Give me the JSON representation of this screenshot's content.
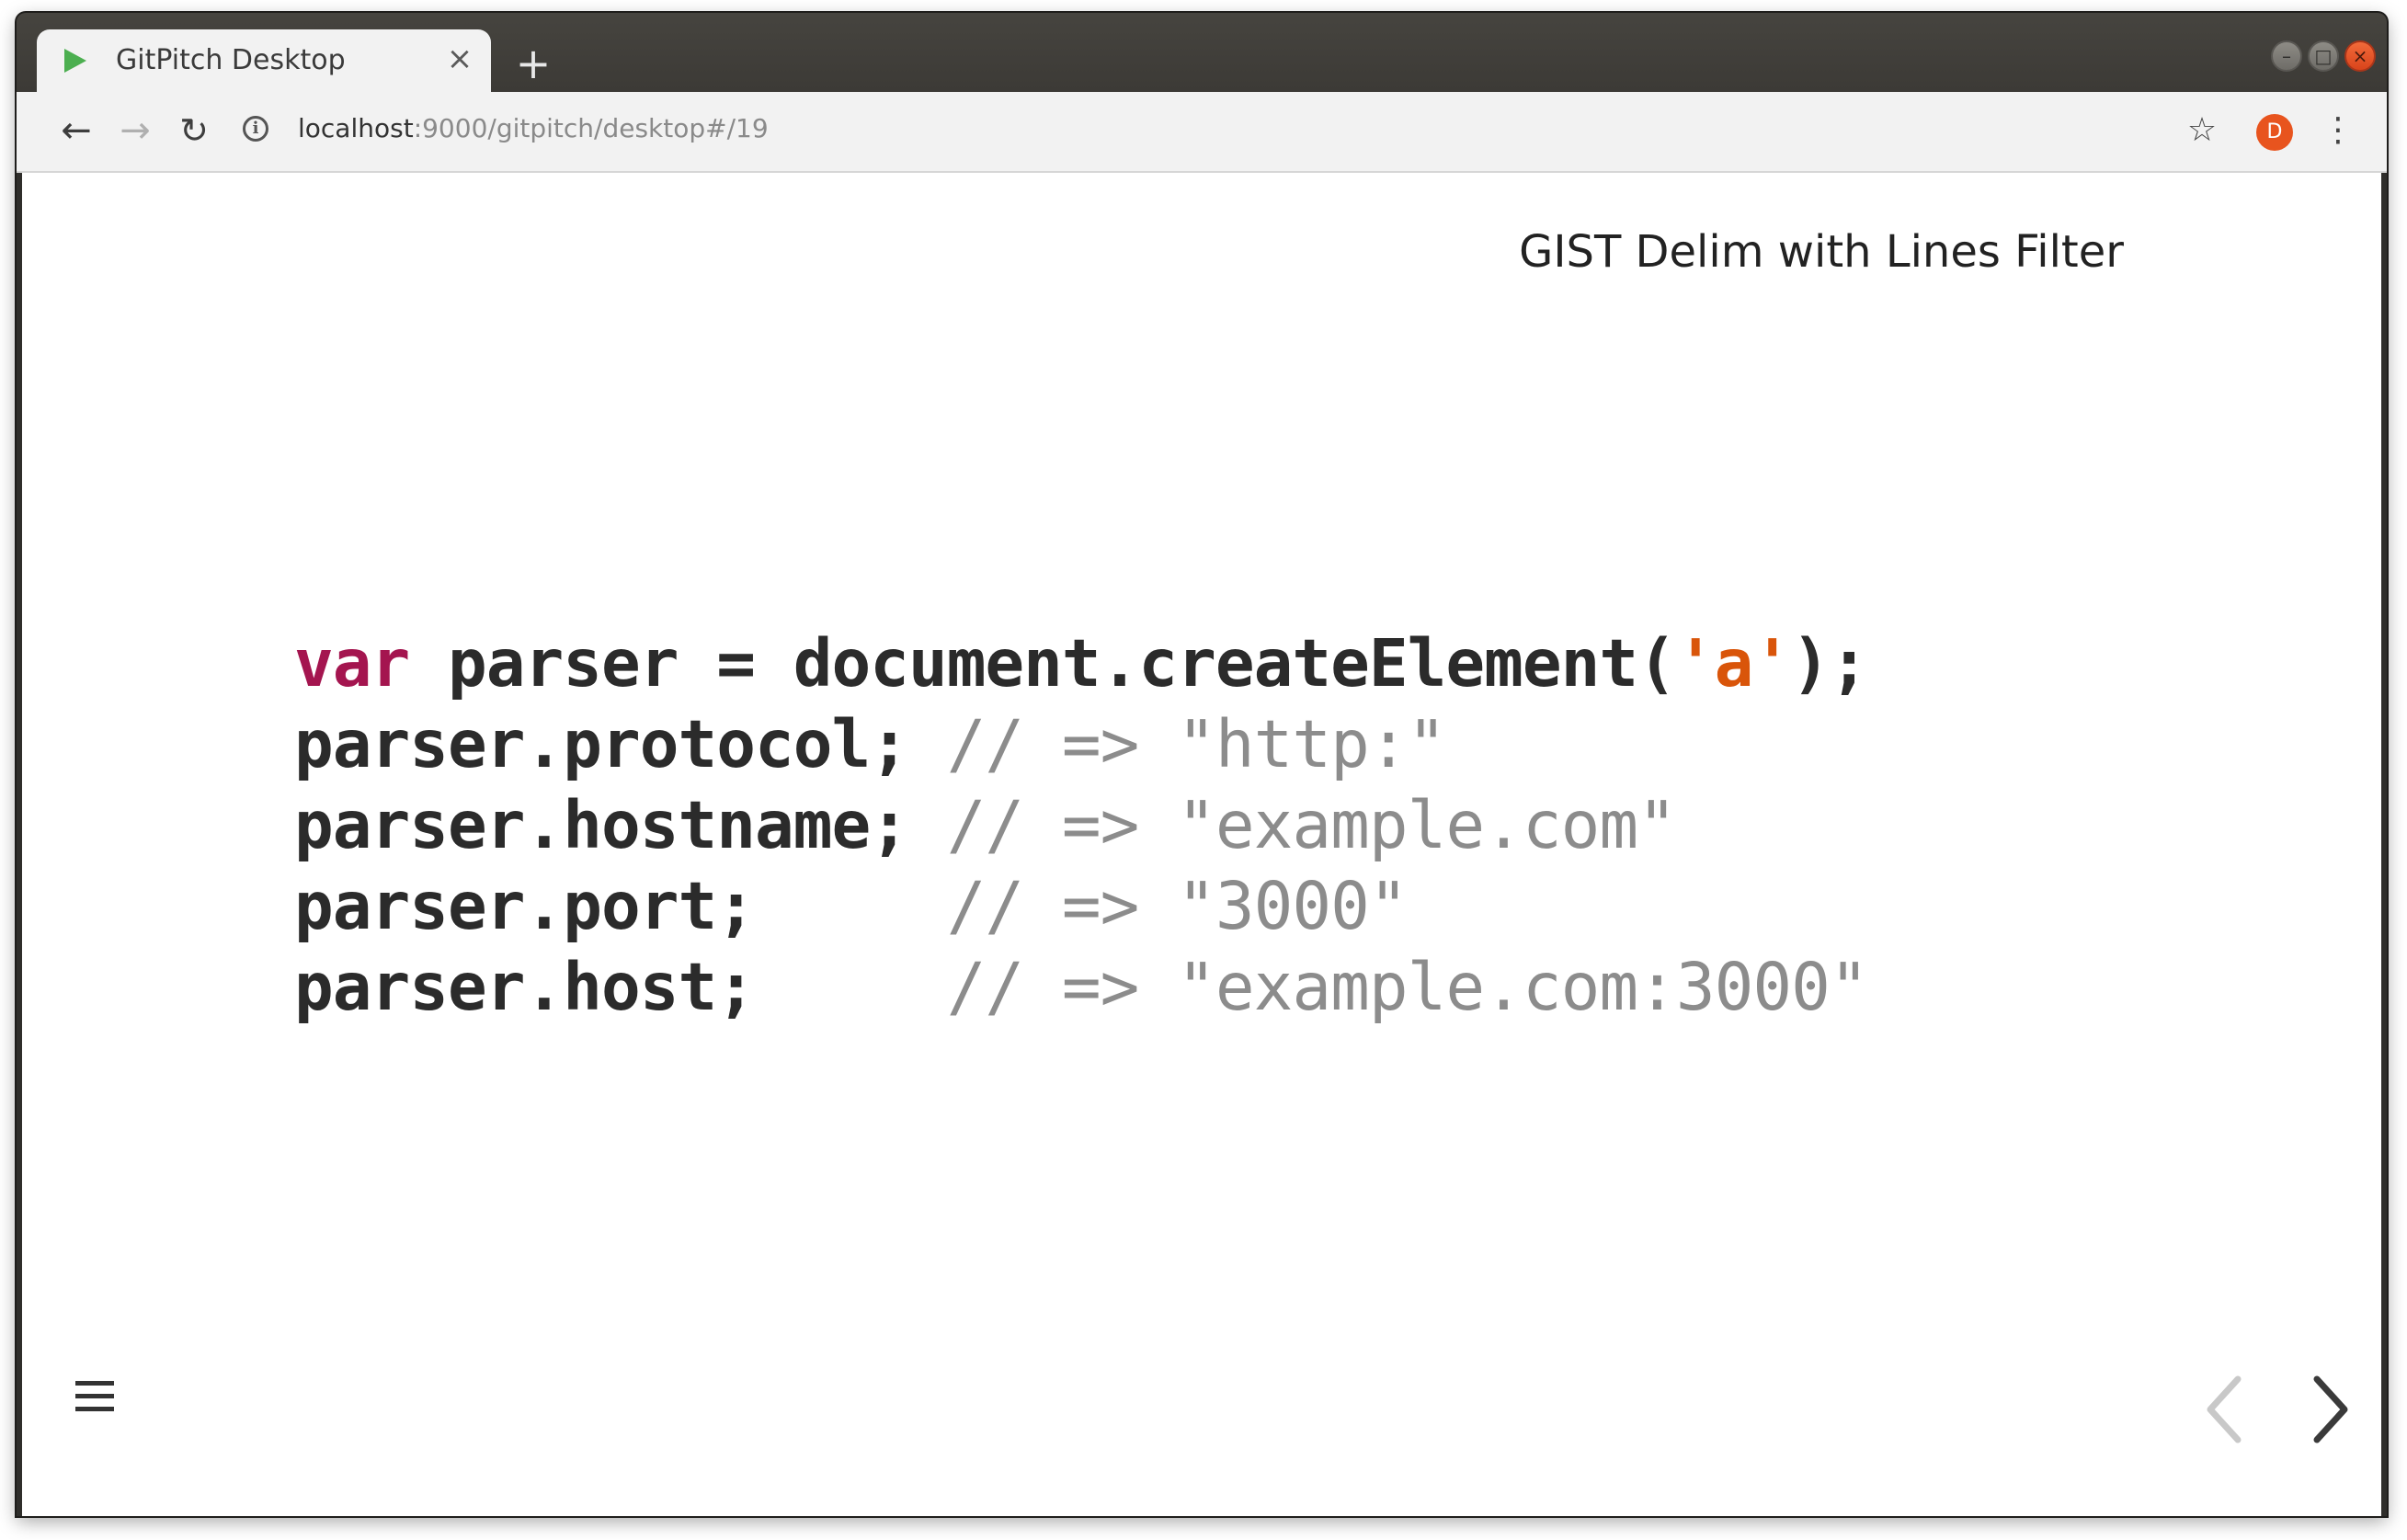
{
  "browser": {
    "tab": {
      "title": "GitPitch Desktop",
      "close": "×"
    },
    "new_tab": "+",
    "url": {
      "host": "localhost",
      "path": ":9000/gitpitch/desktop#/19"
    },
    "avatar_letter": "D",
    "icons": {
      "back": "←",
      "forward": "→",
      "reload": "↻",
      "info": "i",
      "star": "☆",
      "menu": "⋮",
      "minimize": "–",
      "maximize": "□",
      "close": "×"
    }
  },
  "slide": {
    "title": "GIST Delim with Lines Filter",
    "code_lines": [
      [
        {
          "t": "var",
          "c": "kw"
        },
        {
          "t": " parser = document.createElement(",
          "c": ""
        },
        {
          "t": "'a'",
          "c": "str"
        },
        {
          "t": ");",
          "c": ""
        }
      ],
      [
        {
          "t": "parser.protocol; ",
          "c": ""
        },
        {
          "t": "// => \"http:\"",
          "c": "cmt"
        }
      ],
      [
        {
          "t": "parser.hostname; ",
          "c": ""
        },
        {
          "t": "// => \"example.com\"",
          "c": "cmt"
        }
      ],
      [
        {
          "t": "parser.port;     ",
          "c": ""
        },
        {
          "t": "// => \"3000\"",
          "c": "cmt"
        }
      ],
      [
        {
          "t": "parser.host;     ",
          "c": ""
        },
        {
          "t": "// => \"example.com:3000\"",
          "c": "cmt"
        }
      ]
    ]
  },
  "colors": {
    "keyword": "#a4154f",
    "string": "#d9550a",
    "comment": "#8c8c8c",
    "favicon": "#4caf50",
    "avatar": "#e8541e"
  }
}
